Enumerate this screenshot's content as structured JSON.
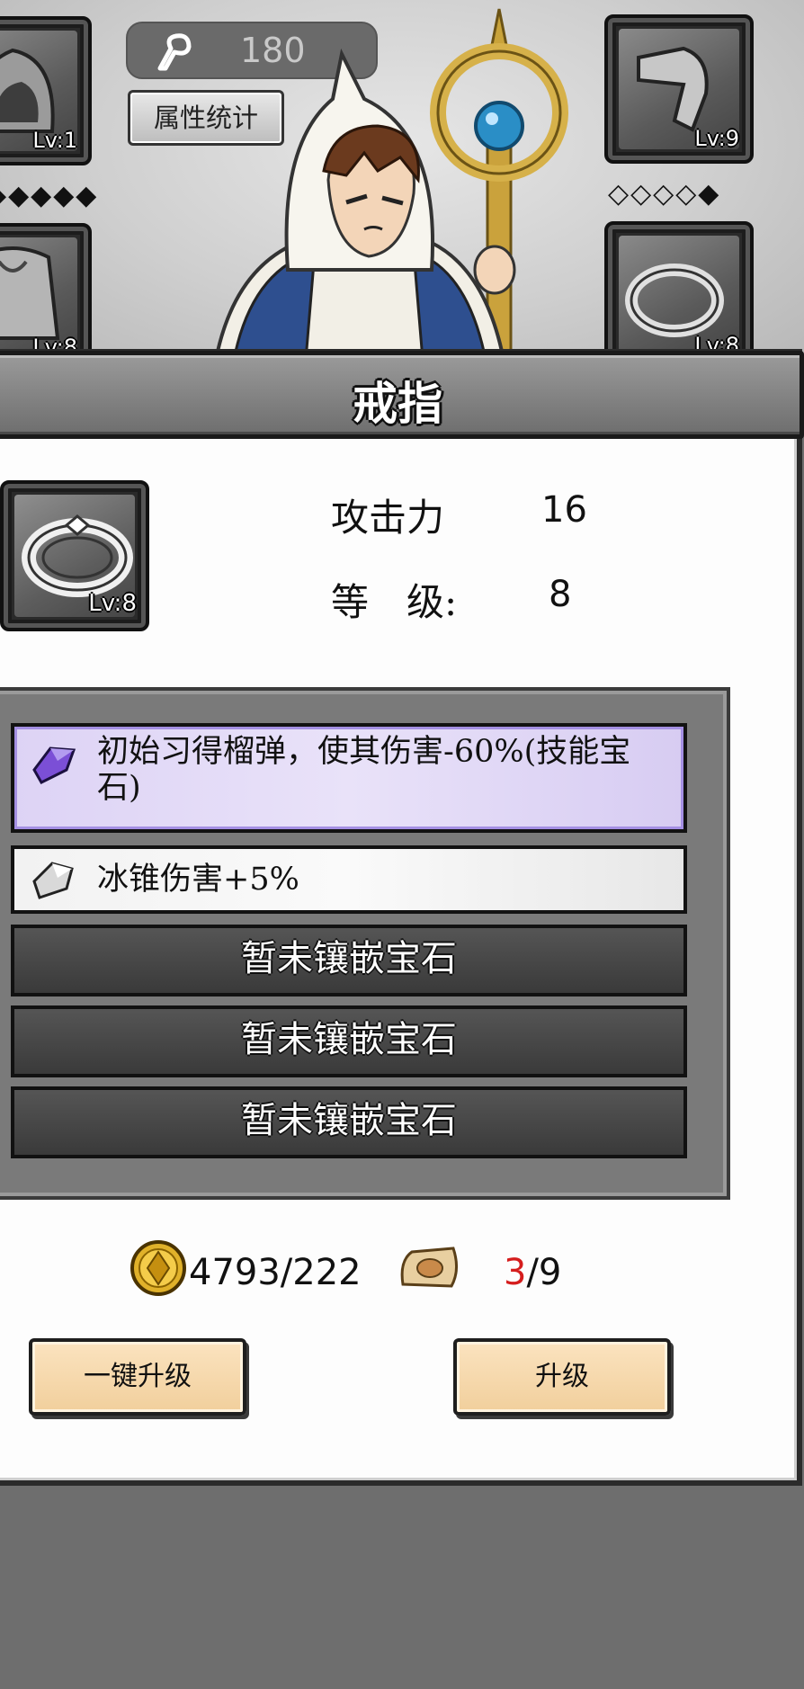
{
  "header": {
    "key_count": "180",
    "stats_button": "属性统计"
  },
  "equipment": {
    "top_left": {
      "level": "Lv:1",
      "stars": "◆◆◆◆◆"
    },
    "top_right": {
      "level": "Lv:9",
      "stars": "◇◇◇◇◆"
    },
    "bottom_left": {
      "level": "Lv:8"
    },
    "bottom_right": {
      "level": "Lv:8"
    }
  },
  "panel": {
    "title": "戒指",
    "item_level": "Lv:8",
    "attack_label": "攻击力",
    "attack_value": "16",
    "level_label": "等　级:",
    "level_value": "8"
  },
  "gems": [
    {
      "type": "skill",
      "icon": "purple-gem-icon",
      "text": "初始习得榴弹，使其伤害-60%(技能宝石)"
    },
    {
      "type": "normal",
      "icon": "white-gem-icon",
      "text": "冰锥伤害+5%"
    },
    {
      "type": "empty",
      "text": "暂未镶嵌宝石"
    },
    {
      "type": "empty",
      "text": "暂未镶嵌宝石"
    },
    {
      "type": "empty",
      "text": "暂未镶嵌宝石"
    }
  ],
  "resources": {
    "gold": "4793/222",
    "scroll_current": "3",
    "scroll_total": "/9"
  },
  "buttons": {
    "one_key_upgrade": "一键升级",
    "upgrade": "升级"
  },
  "colors": {
    "accent_red": "#d51d1d",
    "button_bg": "#f1cf9c",
    "skill_gem": "#7b4fd6"
  }
}
